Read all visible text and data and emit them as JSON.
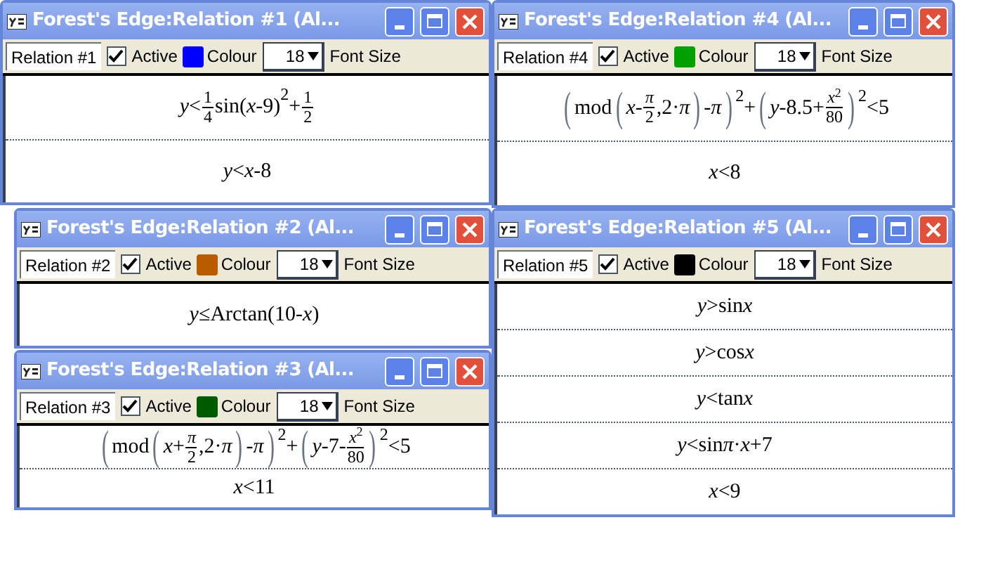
{
  "windows": [
    {
      "title": "Forest's Edge:Relation #1 (Al...",
      "name": "Relation #1",
      "active": true,
      "active_label": "Active",
      "color": "#0000ff",
      "colour_label": "Colour",
      "font_size": "18",
      "font_size_label": "Font Size",
      "relations": [
        {
          "formula": [
            {
              "kind": "t",
              "text": "*y*<"
            },
            {
              "kind": "frac",
              "num": "1",
              "den": "4"
            },
            {
              "kind": "t",
              "text": "sin("
            },
            {
              "kind": "i",
              "text": "x"
            },
            {
              "kind": "t",
              "text": "-9)"
            },
            {
              "kind": "sup",
              "text": "2"
            },
            {
              "kind": "t",
              "text": "+"
            },
            {
              "kind": "frac",
              "num": "1",
              "den": "2"
            }
          ]
        },
        {
          "formula": [
            {
              "kind": "t",
              "text": "*y*<*x*-8"
            }
          ]
        }
      ]
    },
    {
      "title": "Forest's Edge:Relation #4 (Al...",
      "name": "Relation #4",
      "active": true,
      "active_label": "Active",
      "color": "#00a000",
      "colour_label": "Colour",
      "font_size": "18",
      "font_size_label": "Font Size",
      "relations": [
        {
          "formula": [
            {
              "kind": "big",
              "text": "("
            },
            {
              "kind": "t",
              "text": "mod"
            },
            {
              "kind": "big",
              "text": "("
            },
            {
              "kind": "t",
              "text": "*x*-"
            },
            {
              "kind": "frac",
              "num": "*π*",
              "den": "2"
            },
            {
              "kind": "t",
              "text": ",2·*π*"
            },
            {
              "kind": "big",
              "text": ")"
            },
            {
              "kind": "t",
              "text": "-*π*"
            },
            {
              "kind": "big",
              "text": ")"
            },
            {
              "kind": "sup",
              "text": "2"
            },
            {
              "kind": "t",
              "text": "+"
            },
            {
              "kind": "big",
              "text": "("
            },
            {
              "kind": "t",
              "text": "*y*-8.5+"
            },
            {
              "kind": "frac",
              "num": "*x*$^{2}$",
              "den": "80"
            },
            {
              "kind": "big",
              "text": ")"
            },
            {
              "kind": "sup",
              "text": "2"
            },
            {
              "kind": "t",
              "text": "<5"
            }
          ]
        },
        {
          "formula": [
            {
              "kind": "t",
              "text": "*x*<8"
            }
          ]
        }
      ]
    },
    {
      "title": "Forest's Edge:Relation #2 (Al...",
      "name": "Relation #2",
      "active": true,
      "active_label": "Active",
      "color": "#b85c00",
      "colour_label": "Colour",
      "font_size": "18",
      "font_size_label": "Font Size",
      "relations": [
        {
          "formula": [
            {
              "kind": "t",
              "text": "*y*≤Arctan(10-*x*)"
            }
          ]
        }
      ]
    },
    {
      "title": "Forest's Edge:Relation #3 (Al...",
      "name": "Relation #3",
      "active": true,
      "active_label": "Active",
      "color": "#005a00",
      "colour_label": "Colour",
      "font_size": "18",
      "font_size_label": "Font Size",
      "relations": [
        {
          "formula": [
            {
              "kind": "big",
              "text": "("
            },
            {
              "kind": "t",
              "text": "mod"
            },
            {
              "kind": "big",
              "text": "("
            },
            {
              "kind": "t",
              "text": "*x*+"
            },
            {
              "kind": "frac",
              "num": "*π*",
              "den": "2"
            },
            {
              "kind": "t",
              "text": ",2·*π*"
            },
            {
              "kind": "big",
              "text": ")"
            },
            {
              "kind": "t",
              "text": "-*π*"
            },
            {
              "kind": "big",
              "text": ")"
            },
            {
              "kind": "sup",
              "text": "2"
            },
            {
              "kind": "t",
              "text": "+"
            },
            {
              "kind": "big",
              "text": "("
            },
            {
              "kind": "t",
              "text": "*y*-7-"
            },
            {
              "kind": "frac",
              "num": "*x*$^{2}$",
              "den": "80"
            },
            {
              "kind": "big",
              "text": ")"
            },
            {
              "kind": "sup",
              "text": "2"
            },
            {
              "kind": "t",
              "text": "<5"
            }
          ]
        },
        {
          "formula": [
            {
              "kind": "t",
              "text": "*x*<11"
            }
          ]
        }
      ]
    },
    {
      "title": "Forest's Edge:Relation #5 (Al...",
      "name": "Relation #5",
      "active": true,
      "active_label": "Active",
      "color": "#000000",
      "colour_label": "Colour",
      "font_size": "18",
      "font_size_label": "Font Size",
      "relations": [
        {
          "formula": [
            {
              "kind": "t",
              "text": "*y*>sin"
            },
            {
              "kind": "i",
              "text": "x"
            }
          ]
        },
        {
          "formula": [
            {
              "kind": "t",
              "text": "*y*>cos"
            },
            {
              "kind": "i",
              "text": "x"
            }
          ]
        },
        {
          "formula": [
            {
              "kind": "t",
              "text": "*y*<tan"
            },
            {
              "kind": "i",
              "text": "x"
            }
          ]
        },
        {
          "formula": [
            {
              "kind": "t",
              "text": "*y*<sin"
            },
            {
              "kind": "i",
              "text": "π"
            },
            {
              "kind": "t",
              "text": "·*x*+7"
            }
          ]
        },
        {
          "formula": [
            {
              "kind": "t",
              "text": "*x*<9"
            }
          ]
        }
      ]
    }
  ]
}
